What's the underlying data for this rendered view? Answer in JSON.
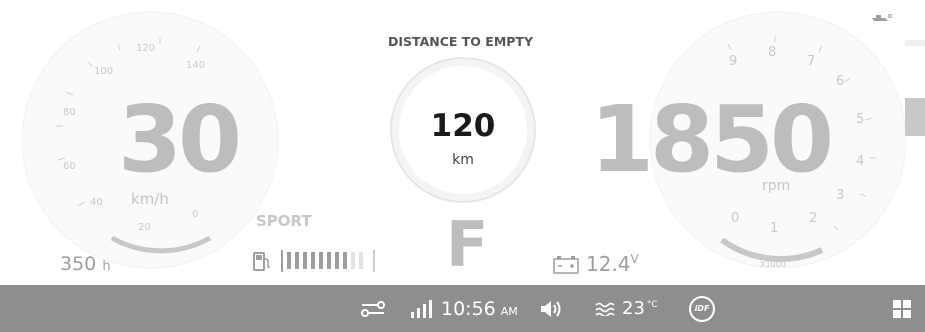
{
  "header": {
    "dte_title": "DISTANCE TO EMPTY",
    "boat_icon": "boat-trim-icon"
  },
  "speed": {
    "value": "30",
    "unit": "km/h",
    "ticks": [
      "20",
      "40",
      "60",
      "80",
      "100",
      "120",
      "140",
      "0"
    ]
  },
  "dte": {
    "value": "120",
    "unit": "km"
  },
  "mode": {
    "label": "SPORT"
  },
  "gear": {
    "value": "F"
  },
  "rpm": {
    "value": "1850",
    "unit": "rpm",
    "ticks": [
      "0",
      "1",
      "2",
      "3",
      "4",
      "5",
      "6",
      "7",
      "8",
      "9"
    ],
    "multiplier": "X1000"
  },
  "hours": {
    "value": "350",
    "unit": "h"
  },
  "fuel": {
    "icon": "fuel-pump-icon",
    "level_segments": 10,
    "filled_segments": 8
  },
  "battery": {
    "icon": "battery-icon",
    "value": "12.4",
    "unit": "V"
  },
  "status_bar": {
    "time": "10:56",
    "ampm": "AM",
    "water_temp": "23",
    "temp_unit": "°C",
    "idf_label": "iDF",
    "icons": [
      "connection-icon",
      "signal-icon",
      "volume-icon",
      "water-temp-icon",
      "idf-icon",
      "apps-grid-icon"
    ]
  },
  "colors": {
    "status_bar_bg": "#8e8e8e",
    "big_number": "#bdbdbd",
    "dark_text": "#1a1a1a"
  }
}
